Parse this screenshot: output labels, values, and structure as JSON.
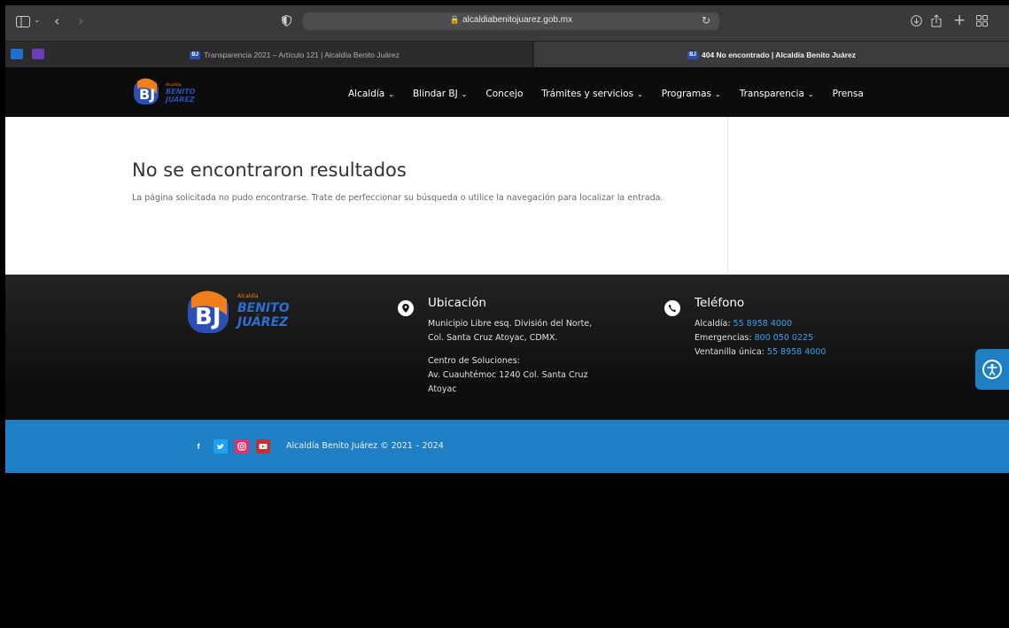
{
  "browser": {
    "url": "alcaldiabenitojuarez.gob.mx",
    "tabs": [
      {
        "label": "Transparencia 2021 – Artículo 121 | Alcaldía Benito Juárez",
        "active": false
      },
      {
        "label": "404 No encontrado | Alcaldía Benito Juárez",
        "active": true
      }
    ],
    "icons": {
      "sidebar": "sidebar-icon",
      "back": "back-icon",
      "forward": "forward-icon",
      "privacy": "shield-icon",
      "reload": "reload-icon",
      "download": "download-icon",
      "share": "share-icon",
      "new_tab": "plus-icon",
      "tab_overview": "grid-icon"
    }
  },
  "header": {
    "logo_small_text": "Alcaldía",
    "logo_line1": "BENITO",
    "logo_line2": "JUÁREZ",
    "nav": [
      {
        "label": "Alcaldía",
        "dropdown": true
      },
      {
        "label": "Blindar BJ",
        "dropdown": true
      },
      {
        "label": "Concejo",
        "dropdown": false
      },
      {
        "label": "Trámites y servicios",
        "dropdown": true
      },
      {
        "label": "Programas",
        "dropdown": true
      },
      {
        "label": "Transparencia",
        "dropdown": true
      },
      {
        "label": "Prensa",
        "dropdown": false
      }
    ]
  },
  "main": {
    "title": "No se encontraron resultados",
    "message": "La página solicitada no pudo encontrarse. Trate de perfeccionar su búsqueda o utilice la navegación para localizar la entrada."
  },
  "footer": {
    "location": {
      "title": "Ubicación",
      "line1": "Municipio Libre esq. División del Norte,",
      "line2": "Col. Santa Cruz Atoyac, CDMX.",
      "line3": "Centro de Soluciones:",
      "line4": "Av. Cuauhtémoc 1240 Col. Santa Cruz",
      "line5": "Atoyac"
    },
    "phone": {
      "title": "Teléfono",
      "rows": [
        {
          "label": "Alcaldía:",
          "value": "55 8958 4000"
        },
        {
          "label": "Emergencias:",
          "value": "800 050 0225"
        },
        {
          "label": "Ventanilla única:",
          "value": "55 8958 4000"
        }
      ]
    }
  },
  "bottom": {
    "copyright": "Alcaldía Benito Juárez © 2021 – 2024",
    "social": [
      {
        "name": "facebook",
        "glyph": "f",
        "color": "#3b5998"
      },
      {
        "name": "twitter",
        "glyph": "t",
        "color": "#1da1f2"
      },
      {
        "name": "instagram",
        "glyph": "◎",
        "color": "#e1306c"
      },
      {
        "name": "youtube",
        "glyph": "▶",
        "color": "#c4302b"
      }
    ]
  },
  "colors": {
    "accent_blue": "#1f7fc4",
    "link_blue": "#2ea3f2",
    "logo_orange": "#f07f1b",
    "logo_blue": "#2b4fb4"
  }
}
